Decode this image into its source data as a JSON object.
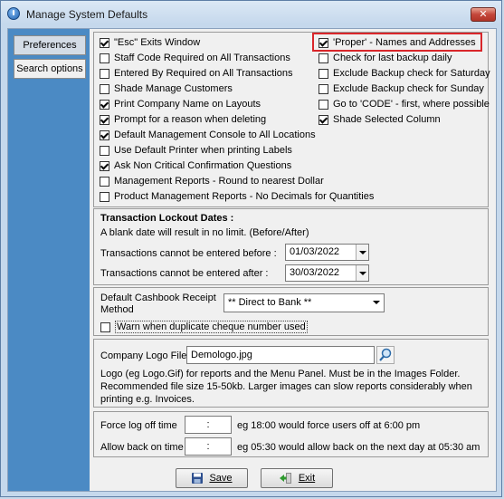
{
  "window": {
    "title": "Manage System Defaults",
    "close_label": "✕"
  },
  "sidebar": {
    "items": [
      {
        "label": "Preferences"
      },
      {
        "label": "Search options"
      }
    ]
  },
  "left_options": [
    {
      "label": "\"Esc\" Exits Window",
      "checked": true
    },
    {
      "label": "Staff Code Required on All Transactions",
      "checked": false
    },
    {
      "label": "Entered By Required on All Transactions",
      "checked": false
    },
    {
      "label": "Shade Manage Customers",
      "checked": false
    },
    {
      "label": "Print Company Name on Layouts",
      "checked": true
    },
    {
      "label": "Prompt for a reason when deleting",
      "checked": true
    },
    {
      "label": "Default Management Console to All Locations",
      "checked": true
    },
    {
      "label": "Use Default Printer when printing Labels",
      "checked": false
    },
    {
      "label": "Ask Non Critical Confirmation Questions",
      "checked": true
    },
    {
      "label": "Management Reports -  Round to nearest Dollar",
      "checked": false
    },
    {
      "label": "Product Management Reports - No Decimals for Quantities",
      "checked": false
    }
  ],
  "right_options": [
    {
      "label": "'Proper' - Names and Addresses",
      "checked": true
    },
    {
      "label": "Check for last backup daily",
      "checked": false
    },
    {
      "label": "Exclude Backup check for Saturday",
      "checked": false
    },
    {
      "label": "Exclude Backup check for Sunday",
      "checked": false
    },
    {
      "label": "Go to 'CODE' - first, where possible",
      "checked": false
    },
    {
      "label": "Shade Selected Column",
      "checked": true
    }
  ],
  "lockout": {
    "heading": "Transaction Lockout Dates :",
    "note": "A blank date will result in no limit. (Before/After)",
    "before_label": "Transactions cannot be entered before :",
    "before_value": "01/03/2022",
    "after_label": "Transactions cannot be entered after :",
    "after_value": "30/03/2022"
  },
  "cashbook": {
    "label_line1": "Default Cashbook Receipt",
    "label_line2": "Method",
    "value": "** Direct to Bank **",
    "warn_label": "Warn when duplicate cheque number used",
    "warn_checked": false
  },
  "logo": {
    "label": "Company Logo File",
    "value": "Demologo.jpg",
    "note_line1": "Logo (eg Logo.Gif) for reports and the Menu Panel. Must be in the Images Folder.",
    "note_line2": "Recommended file size 15-50kb. Larger images can slow reports considerably when",
    "note_line3": "printing e.g. Invoices."
  },
  "times": {
    "logoff_label": "Force log off time",
    "logoff_value": ":",
    "logoff_hint": "eg  18:00  would force users off at 6:00 pm",
    "allow_label": "Allow back on time",
    "allow_value": ":",
    "allow_hint": "eg  05:30  would allow back on the next day at 05:30 am"
  },
  "footer": {
    "save_label": "Save",
    "exit_label": "Exit"
  },
  "colors": {
    "sidebar": "#4b8ac4",
    "highlight": "#d9262a",
    "title_bg": "#c5d8ec"
  }
}
